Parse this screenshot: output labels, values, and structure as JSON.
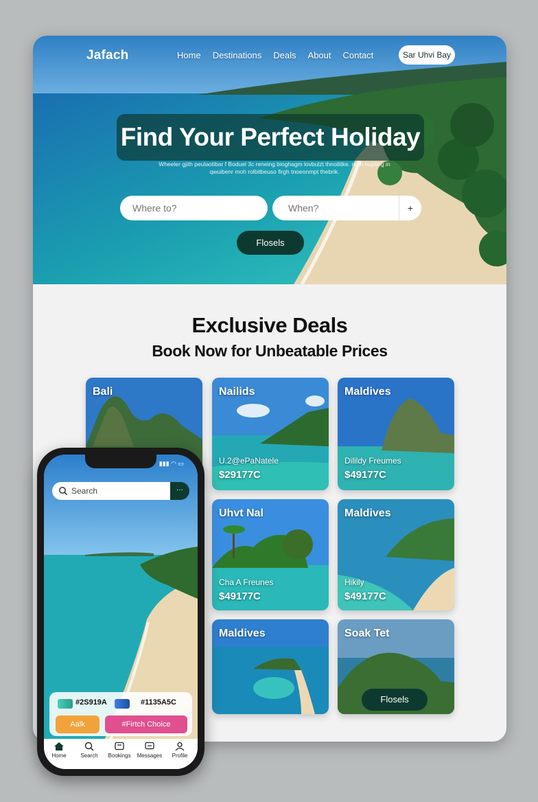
{
  "brand": "Jafach",
  "nav": {
    "links": [
      "Home",
      "Destinations",
      "Deals",
      "About",
      "Contact"
    ],
    "cta": "Sar Uhvi Bay"
  },
  "hero": {
    "title": "Find Your Perfect Holiday",
    "subtitle": "Wheeler gjith peulaotibar f Boduel 3c reneing bioghagm lovbulzt thnoilitke. nrnh hupting in qwuibenr moh rolbitbeuso firgh tnoeonmpt thebrik.",
    "where_placeholder": "Where to?",
    "when_placeholder": "When?",
    "when_button": "+",
    "button": "Flosels"
  },
  "deals": {
    "title": "Exclusive Deals",
    "subtitle": "Book Now for Unbeatable Prices",
    "cards": [
      {
        "name": "Bali",
        "feature": "",
        "price": ""
      },
      {
        "name": "Nailids",
        "feature": "U.2@ePaNatele",
        "price": "$29177C"
      },
      {
        "name": "Maldives",
        "feature": "Dilildy Freumes",
        "price": "$49177C"
      },
      {
        "name": "Uhvt Nal",
        "feature": "Cha A Freunes",
        "price": "$49177C"
      },
      {
        "name": "Maldives",
        "feature": "Hikily",
        "price": "$49177C"
      },
      {
        "name": "Maldives",
        "feature": "",
        "price": ""
      },
      {
        "name": "Soak Tet",
        "button": "Flosels"
      }
    ]
  },
  "phone": {
    "search_placeholder": "Search",
    "search_button": "···",
    "palette": {
      "swatch1": "#2S919A",
      "swatch2": "#1135A5C",
      "btn1": "Aalk",
      "btn2": "#Firtch Choice"
    },
    "tabs": [
      "Home",
      "Search",
      "Bookings",
      "Messages",
      "Profile"
    ]
  },
  "colors": {
    "accent": "#0d3a30",
    "orange": "#f2a23a",
    "pink": "#e0508f"
  }
}
